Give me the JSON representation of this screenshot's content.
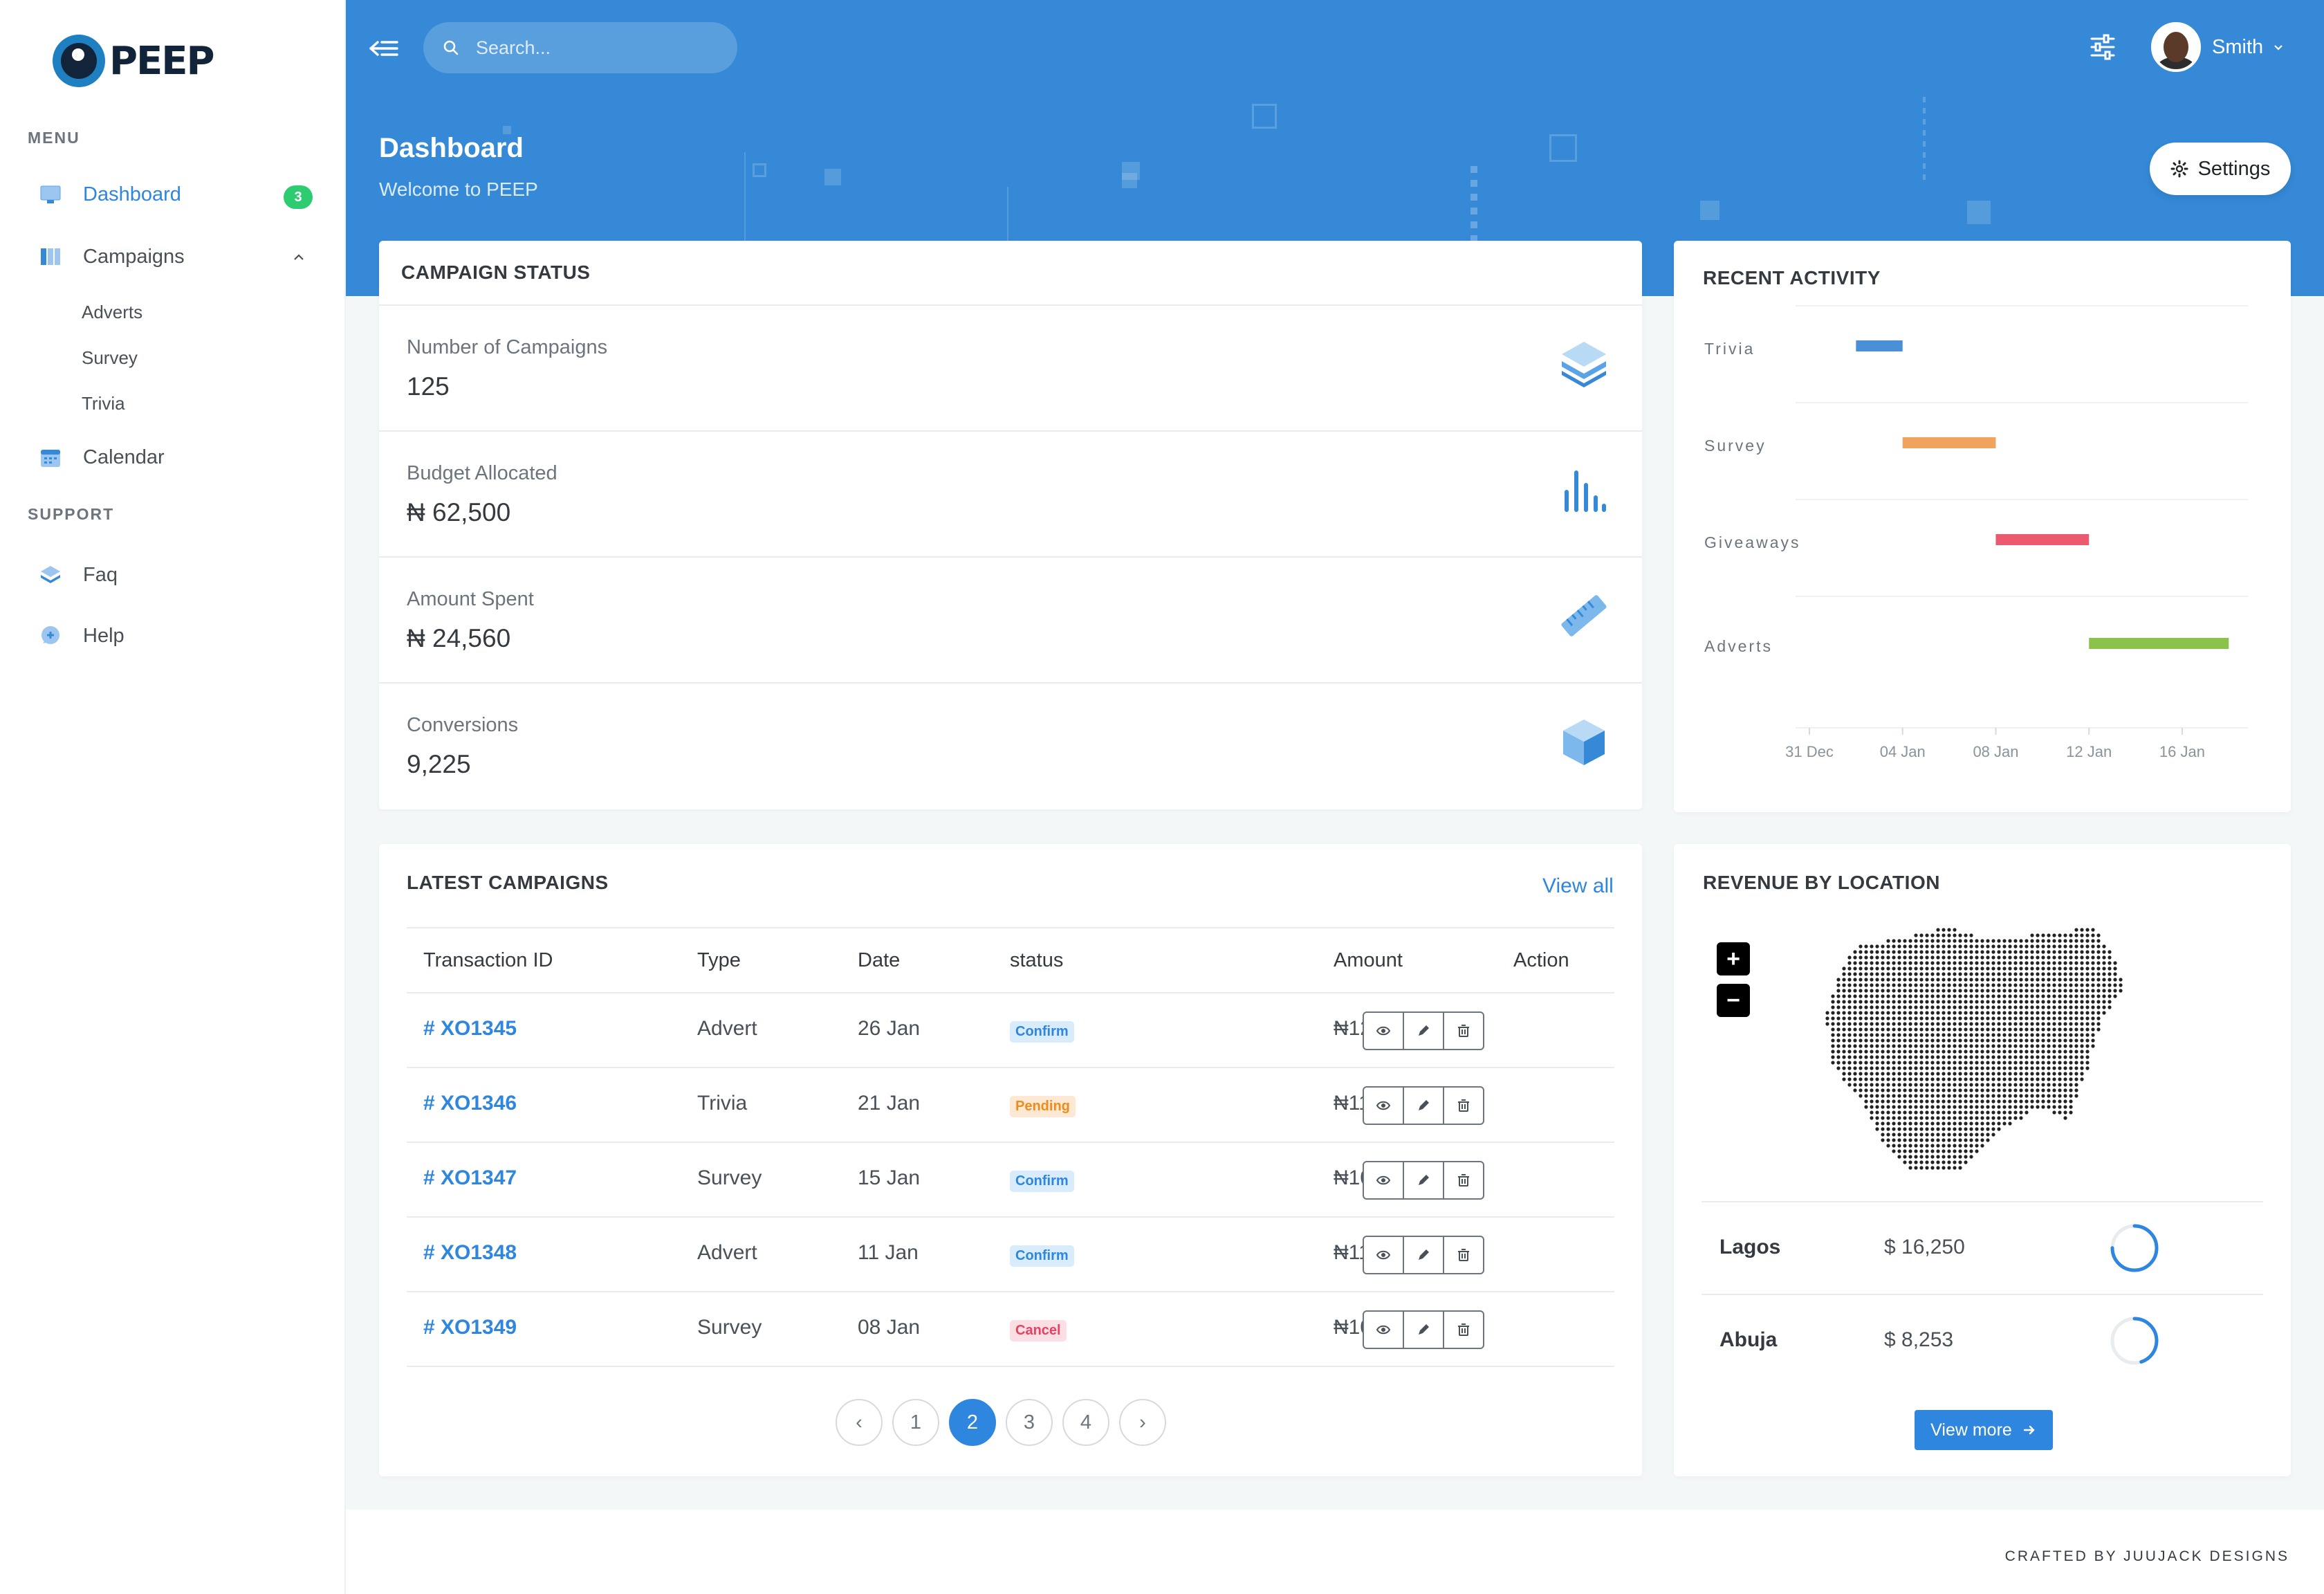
{
  "app": {
    "logo_text": "PEEP"
  },
  "sidebar": {
    "menu_title": "MENU",
    "support_title": "SUPPORT",
    "dashboard": {
      "label": "Dashboard",
      "badge": "3"
    },
    "campaigns": {
      "label": "Campaigns",
      "children": [
        "Adverts",
        "Survey",
        "Trivia"
      ]
    },
    "calendar": {
      "label": "Calendar"
    },
    "faq": {
      "label": "Faq"
    },
    "help": {
      "label": "Help"
    }
  },
  "header": {
    "search_placeholder": "Search...",
    "user_name": "Smith",
    "title": "Dashboard",
    "subtitle": "Welcome to PEEP",
    "settings_label": "Settings"
  },
  "campaign_status": {
    "title": "CAMPAIGN STATUS",
    "items": [
      {
        "label": "Number of Campaigns",
        "value": "125",
        "icon": "layers-icon"
      },
      {
        "label": "Budget Allocated",
        "value": "₦ 62,500",
        "icon": "bar-chart-icon"
      },
      {
        "label": "Amount Spent",
        "value": "₦ 24,560",
        "icon": "ruler-icon"
      },
      {
        "label": "Conversions",
        "value": "9,225",
        "icon": "cube-icon"
      }
    ]
  },
  "recent_activity": {
    "title": "RECENT ACTIVITY",
    "chart_data": {
      "type": "bar",
      "orientation": "horizontal-range",
      "categories": [
        "Trivia",
        "Survey",
        "Giveaways",
        "Adverts"
      ],
      "x_ticks": [
        "31 Dec",
        "04 Jan",
        "08 Jan",
        "12 Jan",
        "16 Jan"
      ],
      "xlim": [
        "31 Dec",
        "19 Jan"
      ],
      "series": [
        {
          "category": "Trivia",
          "start": "33 Dec",
          "end": "35 Dec",
          "color": "#4a90d9"
        },
        {
          "category": "Survey",
          "start": "04 Jan",
          "end": "08 Jan",
          "color": "#f0a35e"
        },
        {
          "category": "Giveaways",
          "start": "08 Jan",
          "end": "12 Jan",
          "color": "#eb5a6f"
        },
        {
          "category": "Adverts",
          "start": "12 Jan",
          "end": "18 Jan",
          "color": "#8bc34a"
        }
      ],
      "grid": true
    }
  },
  "latest_campaigns": {
    "title": "LATEST CAMPAIGNS",
    "view_all": "View all",
    "columns": [
      "Transaction ID",
      "Type",
      "Date",
      "status",
      "Amount",
      "Action"
    ],
    "rows": [
      {
        "id": "# XO1345",
        "type": "Advert",
        "date": "26 Jan",
        "status": "Confirm",
        "status_kind": "confirm",
        "amount": "₦124"
      },
      {
        "id": "# XO1346",
        "type": "Trivia",
        "date": "21 Jan",
        "status": "Pending",
        "status_kind": "pending",
        "amount": "₦112"
      },
      {
        "id": "# XO1347",
        "type": "Survey",
        "date": "15 Jan",
        "status": "Confirm",
        "status_kind": "confirm",
        "amount": "₦106"
      },
      {
        "id": "# XO1348",
        "type": "Advert",
        "date": "11 Jan",
        "status": "Confirm",
        "status_kind": "confirm",
        "amount": "₦115"
      },
      {
        "id": "# XO1349",
        "type": "Survey",
        "date": "08 Jan",
        "status": "Cancel",
        "status_kind": "cancel",
        "amount": "₦105"
      }
    ],
    "pagination": {
      "pages": [
        "1",
        "2",
        "3",
        "4"
      ],
      "current": "2",
      "prev": "‹",
      "next": "›"
    }
  },
  "revenue": {
    "title": "REVENUE BY LOCATION",
    "zoom_in": "+",
    "zoom_out": "−",
    "locations": [
      {
        "city": "Lagos",
        "amount": "$ 16,250",
        "progress": 0.75
      },
      {
        "city": "Abuja",
        "amount": "$ 8,253",
        "progress": 0.45
      }
    ],
    "view_more": "View more"
  },
  "footer": {
    "text": "CRAFTED BY JUUJACK DESIGNS"
  },
  "colors": {
    "primary": "#3589d6",
    "accent": "#2e86de",
    "success": "#2ecc71"
  }
}
